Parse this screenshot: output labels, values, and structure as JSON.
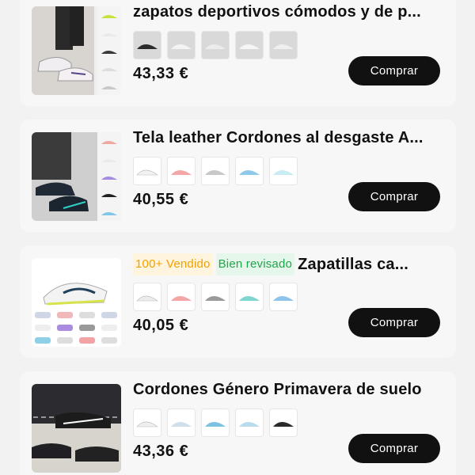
{
  "products": [
    {
      "title": "zapatos deportivos cómodos y de p...",
      "price": "43,33 €",
      "button": "Comprar",
      "badges": []
    },
    {
      "title": "Tela leather Cordones al desgaste A...",
      "price": "40,55 €",
      "button": "Comprar",
      "badges": []
    },
    {
      "title": "Zapatillas ca...",
      "price": "40,05 €",
      "button": "Comprar",
      "badges": [
        "100+ Vendido",
        "Bien revisado"
      ]
    },
    {
      "title": "Cordones Género Primavera de suelo",
      "price": "43,36 €",
      "button": "Comprar",
      "badges": []
    }
  ],
  "colors": {
    "button_bg": "#111111",
    "sold_badge": "#f2a100",
    "review_badge": "#1fa54a"
  }
}
